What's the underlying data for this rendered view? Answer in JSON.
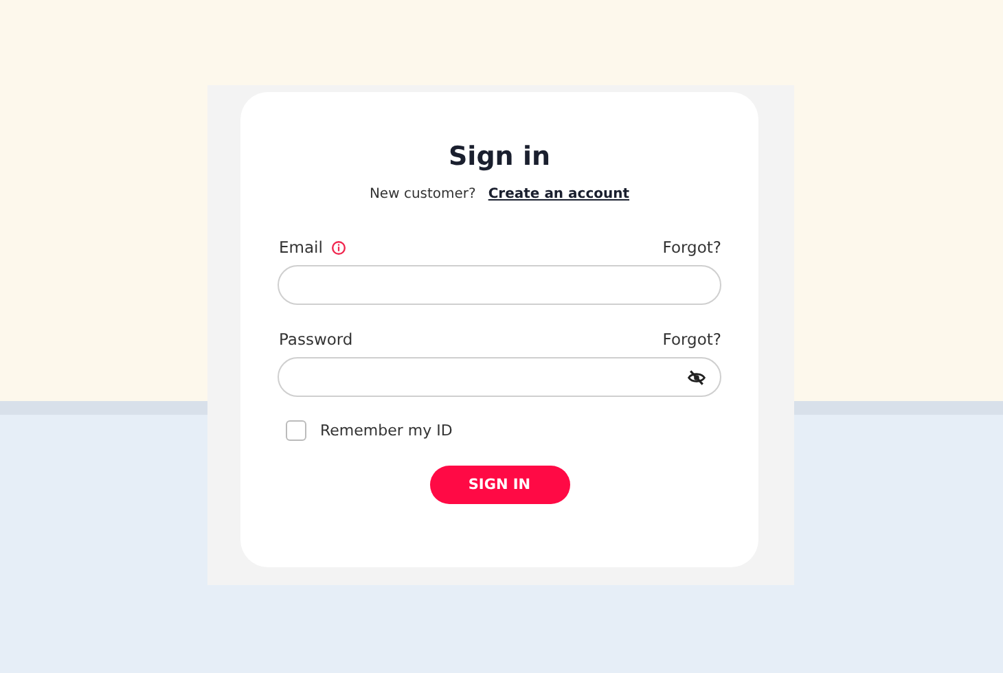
{
  "title": "Sign in",
  "signup": {
    "prompt": "New customer?",
    "link": "Create an account"
  },
  "fields": [
    {
      "kind": "email",
      "label": "Email",
      "link": "Forgot?"
    },
    {
      "kind": "password",
      "label": "Password",
      "link": "Forgot?"
    }
  ],
  "remember": {
    "label": "Remember my ID",
    "checked": false
  },
  "button": "SIGN IN"
}
